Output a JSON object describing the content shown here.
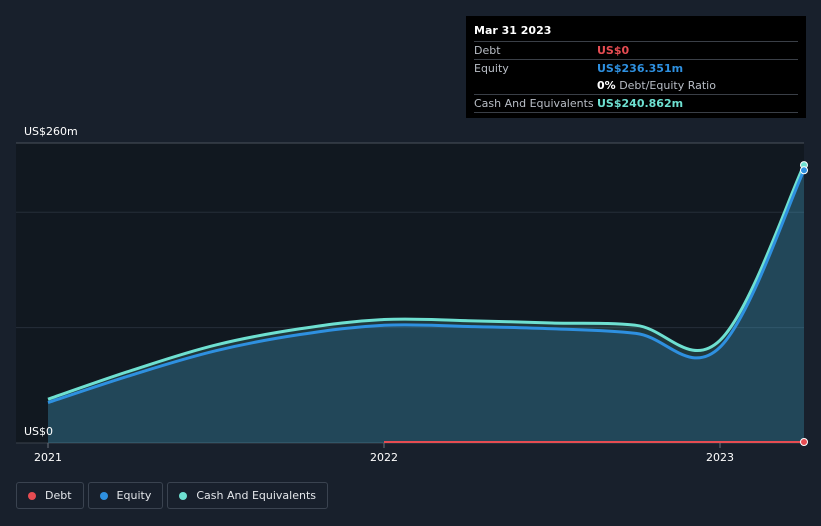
{
  "tooltip": {
    "date": "Mar 31 2023",
    "rows": {
      "debt": {
        "label": "Debt",
        "value": "US$0"
      },
      "equity": {
        "label": "Equity",
        "value": "US$236.351m"
      },
      "ratio": {
        "value": "0%",
        "label": "Debt/Equity Ratio"
      },
      "cash": {
        "label": "Cash And Equivalents",
        "value": "US$240.862m"
      }
    }
  },
  "legend": {
    "debt": "Debt",
    "equity": "Equity",
    "cash": "Cash And Equivalents"
  },
  "colors": {
    "debt": "#e64c52",
    "equity": "#2e90e0",
    "cash": "#6ee0d1",
    "background": "#18202c",
    "plot_background": "#111820"
  },
  "chart_data": {
    "type": "area",
    "y_axis": {
      "label_top": "US$260m",
      "label_bottom": "US$0",
      "ylim": [
        0,
        260
      ]
    },
    "x_ticks": [
      "2021",
      "2022",
      "2023"
    ],
    "x_tick_positions_years": [
      2021.0,
      2022.0,
      2023.0
    ],
    "xlim": [
      2021.0,
      2023.25
    ],
    "series": [
      {
        "name": "Debt",
        "x": [
          2022.0,
          2023.25
        ],
        "values": [
          0,
          0
        ]
      },
      {
        "name": "Equity",
        "x": [
          2021.0,
          2021.25,
          2021.5,
          2021.75,
          2022.0,
          2022.25,
          2022.5,
          2022.75,
          2023.0,
          2023.25
        ],
        "values": [
          35,
          59,
          80,
          94,
          102,
          101,
          99,
          95,
          83,
          236.351
        ]
      },
      {
        "name": "Cash And Equivalents",
        "x": [
          2021.0,
          2021.25,
          2021.5,
          2021.75,
          2022.0,
          2022.25,
          2022.5,
          2022.75,
          2023.0,
          2023.25
        ],
        "values": [
          38,
          63,
          85,
          99,
          107,
          106,
          104,
          102,
          89,
          240.862
        ]
      }
    ]
  }
}
